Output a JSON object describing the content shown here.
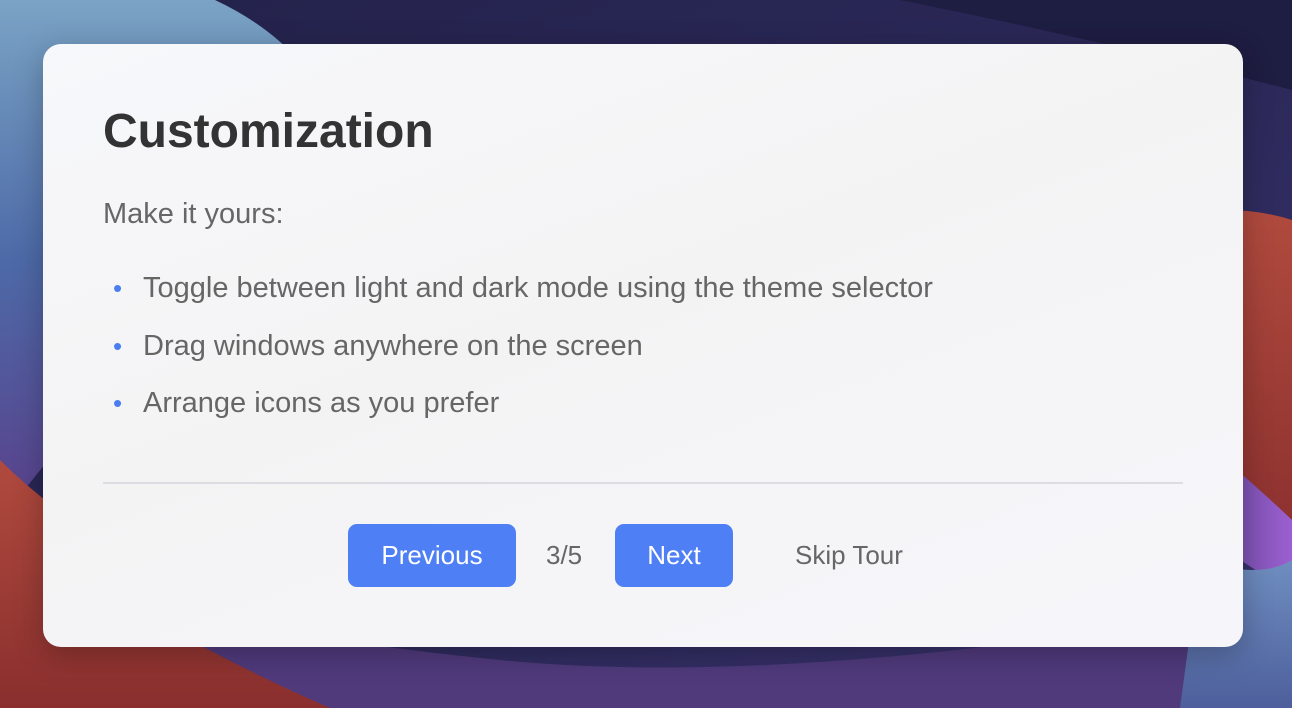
{
  "tour": {
    "title": "Customization",
    "intro": "Make it yours:",
    "items": [
      {
        "label": "Toggle between light and dark mode using the theme selector"
      },
      {
        "label": "Drag windows anywhere on the screen"
      },
      {
        "label": "Arrange icons as you prefer"
      }
    ],
    "bullet": "•",
    "previous_label": "Previous",
    "page_indicator": "3/5",
    "next_label": "Next",
    "skip_label": "Skip Tour"
  },
  "colors": {
    "accent": "#4e7ff5",
    "title_text": "#333333",
    "body_text": "#666666",
    "card_background": "#f5f5f8"
  }
}
